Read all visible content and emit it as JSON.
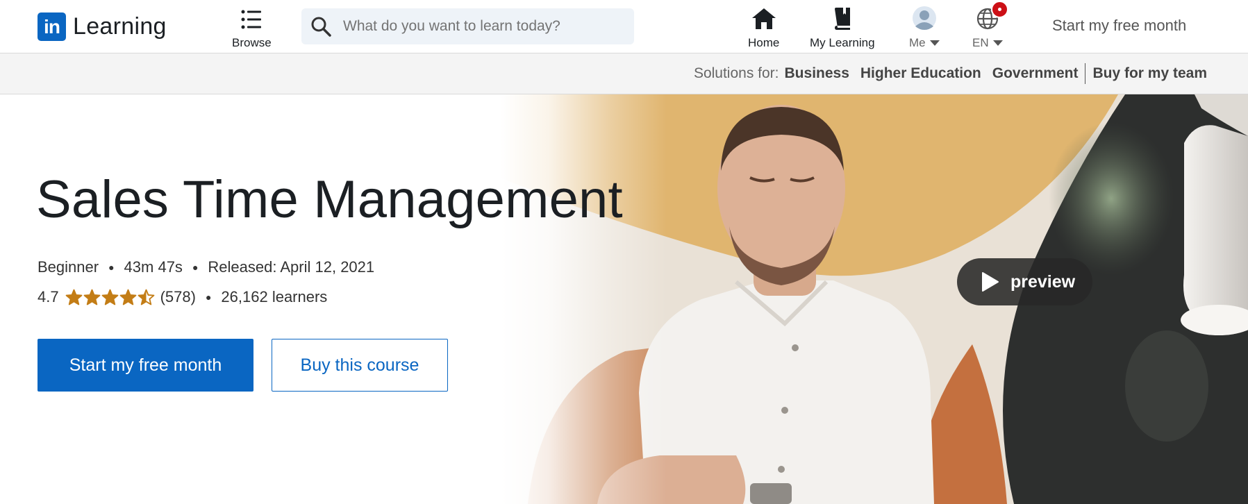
{
  "header": {
    "logo_mark": "in",
    "logo_text": "Learning",
    "browse_label": "Browse",
    "search_placeholder": "What do you want to learn today?",
    "nav": {
      "home": "Home",
      "my_learning": "My Learning",
      "me": "Me",
      "language": "EN"
    },
    "cta": "Start my free month"
  },
  "solutions": {
    "label": "Solutions for:",
    "links": [
      "Business",
      "Higher Education",
      "Government",
      "Buy for my team"
    ]
  },
  "course": {
    "title": "Sales Time Management",
    "level": "Beginner",
    "duration": "43m 47s",
    "released": "Released: April 12, 2021",
    "rating": "4.7",
    "rating_value": 4.7,
    "rating_max": 5,
    "reviews": "(578)",
    "learners": "26,162 learners",
    "primary_cta": "Start my free month",
    "secondary_cta": "Buy this course",
    "preview_label": "preview"
  },
  "icons": {
    "search": "search-icon",
    "browse": "list-icon",
    "home": "home-icon",
    "my_learning": "book-icon",
    "me": "avatar-icon",
    "language": "globe-icon",
    "preview": "play-icon",
    "star": "star-icon"
  },
  "colors": {
    "brand": "#0a66c2",
    "star": "#c37d16",
    "notification": "#cc1016"
  }
}
